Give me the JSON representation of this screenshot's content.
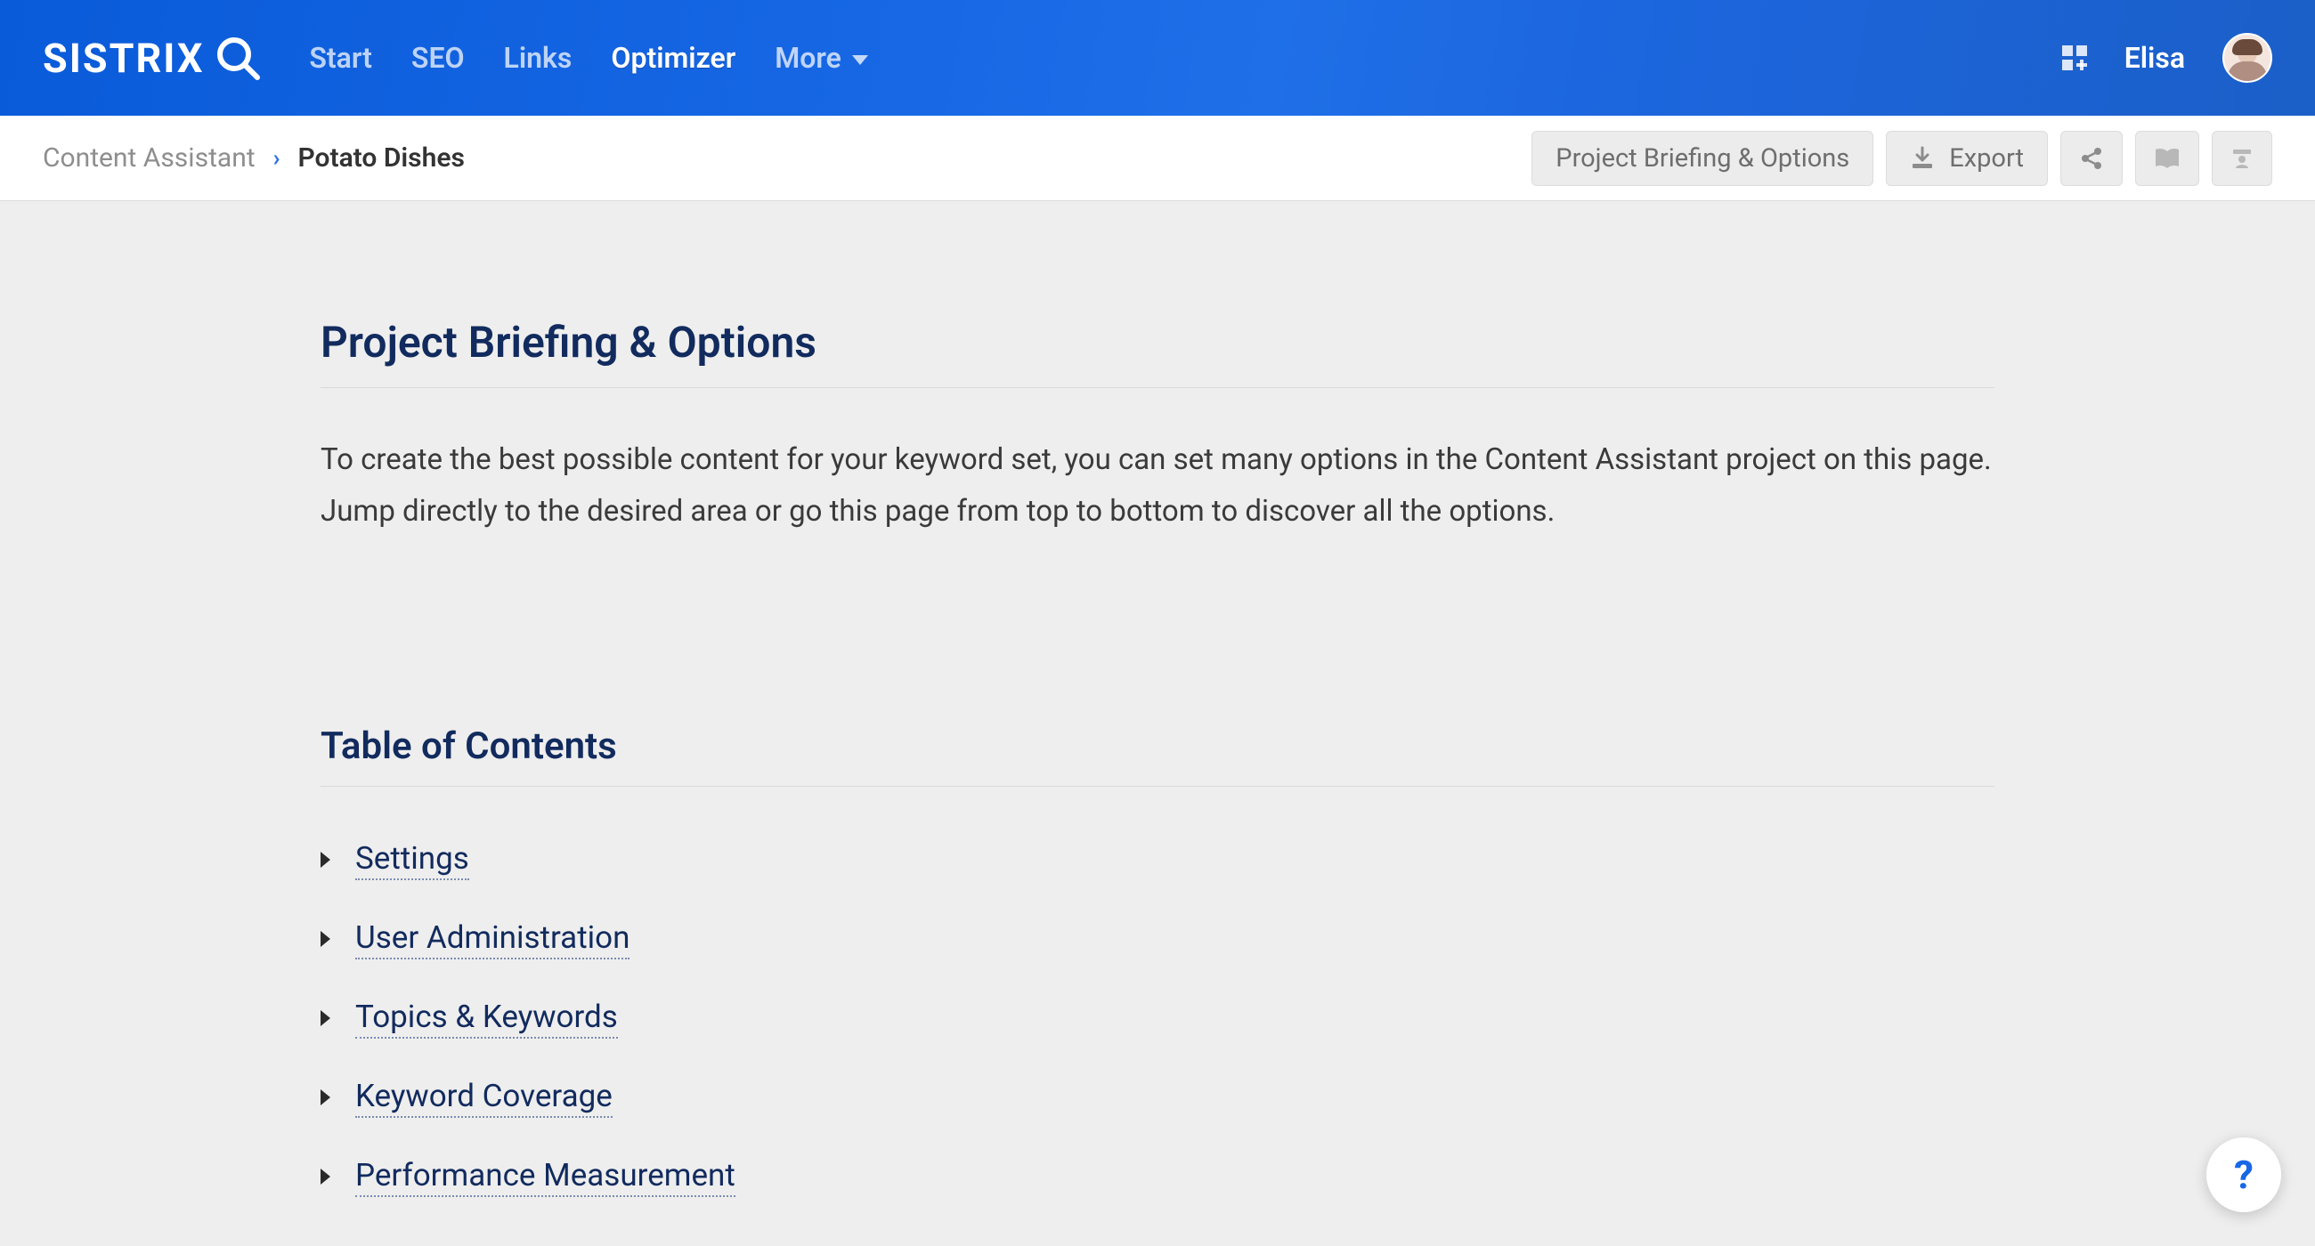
{
  "brand": "SISTRIX",
  "nav": {
    "items": [
      "Start",
      "SEO",
      "Links",
      "Optimizer",
      "More"
    ],
    "active_index": 3
  },
  "user": {
    "name": "Elisa"
  },
  "breadcrumb": {
    "parent": "Content Assistant",
    "current": "Potato Dishes"
  },
  "actions": {
    "briefing": "Project Briefing & Options",
    "export": "Export"
  },
  "page": {
    "title": "Project Briefing & Options",
    "intro": "To create the best possible content for your keyword set, you can set many options in the Content Assistant project on this page. Jump directly to the desired area or go this page from top to bottom to discover all the options."
  },
  "toc": {
    "title": "Table of Contents",
    "items": [
      "Settings",
      "User Administration",
      "Topics & Keywords",
      "Keyword Coverage",
      "Performance Measurement"
    ]
  },
  "help": "?"
}
